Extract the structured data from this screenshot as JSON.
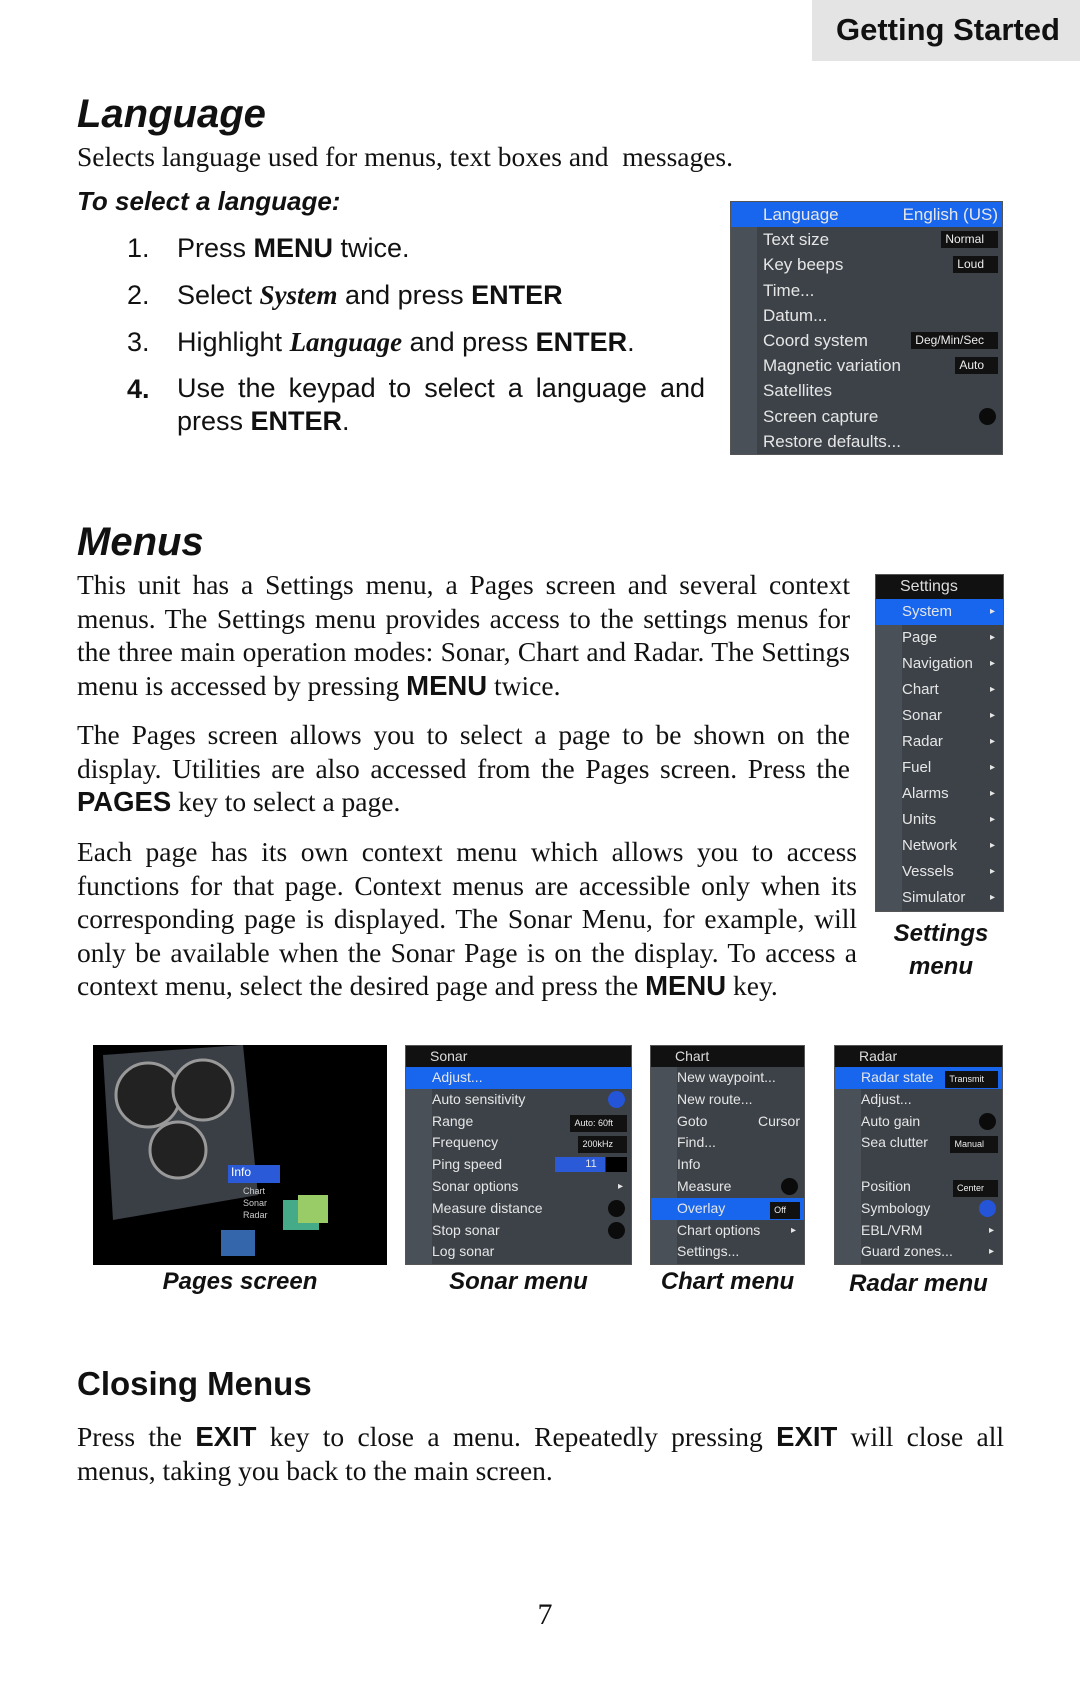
{
  "header": {
    "section": "Getting Started"
  },
  "language": {
    "title": "Language",
    "description": "Selects language used for menus, text boxes and  messages.",
    "howto": "To select a language:",
    "steps": [
      {
        "n": "1.",
        "parts": [
          [
            "Press ",
            ""
          ],
          [
            "MENU",
            "b"
          ],
          [
            " twice.",
            ""
          ]
        ]
      },
      {
        "n": "2.",
        "parts": [
          [
            "Select ",
            ""
          ],
          [
            "System",
            "i"
          ],
          [
            " and press ",
            ""
          ],
          [
            "ENTER",
            "b"
          ]
        ]
      },
      {
        "n": "3.",
        "parts": [
          [
            "Highlight ",
            ""
          ],
          [
            "Language",
            "i"
          ],
          [
            " and press ",
            ""
          ],
          [
            "ENTER",
            "b"
          ],
          [
            ".",
            ""
          ]
        ]
      },
      {
        "n": "4.",
        "parts": [
          [
            "Use the keypad to select a language and press ",
            ""
          ],
          [
            "ENTER",
            "b"
          ],
          [
            ".",
            ""
          ]
        ]
      }
    ],
    "screen": {
      "rows": [
        {
          "label": "Language",
          "value": "English (US)",
          "sel": true
        },
        {
          "label": "Text size",
          "dropdown": "Normal"
        },
        {
          "label": "Key beeps",
          "dropdown": "Loud"
        },
        {
          "label": "Time..."
        },
        {
          "label": "Datum..."
        },
        {
          "label": "Coord system",
          "dropdown": "Deg/Min/Sec"
        },
        {
          "label": "Magnetic variation",
          "dropdown": "Auto"
        },
        {
          "label": "Satellites"
        },
        {
          "label": "Screen capture",
          "toggle": "off"
        },
        {
          "label": "Restore defaults..."
        }
      ]
    }
  },
  "menus": {
    "title": "Menus",
    "p1": [
      [
        "This unit has a Settings menu, a Pages screen and several context menus. The Settings menu provides access to the settings menus for the three main operation modes: Sonar, Chart and Radar. The Settings menu is accessed by pressing ",
        ""
      ],
      [
        "MENU",
        "b"
      ],
      [
        " twice.",
        ""
      ]
    ],
    "p2": [
      [
        "The Pages screen allows you to select a page to be shown on the display. Utilities are also accessed from the Pages screen. Press the ",
        ""
      ],
      [
        "PAGES",
        "b"
      ],
      [
        " key to select a page.",
        ""
      ]
    ],
    "p3": [
      [
        "Each page has its own context menu which allows you to access functions for that page. Context menus are accessible only when its corresponding page is displayed. The Sonar Menu, for example, will only be available when the Sonar Page is on the display. To access a context menu, select the desired page and press the ",
        ""
      ],
      [
        "MENU",
        "b"
      ],
      [
        " key.",
        ""
      ]
    ],
    "settings": {
      "header": "Settings",
      "caption": "Settings menu",
      "items": [
        "System",
        "Page",
        "Navigation",
        "Chart",
        "Sonar",
        "Radar",
        "Fuel",
        "Alarms",
        "Units",
        "Network",
        "Vessels",
        "Simulator"
      ],
      "selected": "System"
    },
    "pages": {
      "caption": "Pages screen",
      "labels": [
        "Info",
        "Chart",
        "Sonar",
        "Radar"
      ]
    },
    "sonar": {
      "header": "Sonar",
      "caption": "Sonar menu",
      "rows": [
        {
          "label": "Adjust...",
          "sel": true
        },
        {
          "label": "Auto sensitivity",
          "toggle": "on"
        },
        {
          "label": "Range",
          "dropdown": "Auto: 60ft"
        },
        {
          "label": "Frequency",
          "dropdown": "200kHz"
        },
        {
          "label": "Ping speed",
          "slider": "11"
        },
        {
          "label": "Sonar options",
          "arrow": true
        },
        {
          "label": "Measure distance",
          "toggle": "off"
        },
        {
          "label": "Stop sonar",
          "toggle": "off"
        },
        {
          "label": "Log sonar"
        }
      ]
    },
    "chart": {
      "header": "Chart",
      "caption": "Chart menu",
      "rows": [
        {
          "label": "New waypoint..."
        },
        {
          "label": "New route..."
        },
        {
          "label": "Goto",
          "value": "Cursor"
        },
        {
          "label": "Find..."
        },
        {
          "label": "Info"
        },
        {
          "label": "Measure",
          "toggle": "off"
        },
        {
          "label": "Overlay",
          "dropdown": "Off",
          "sel": true
        },
        {
          "label": "Chart options",
          "arrow": true
        },
        {
          "label": "Settings..."
        }
      ]
    },
    "radar": {
      "header": "Radar",
      "caption": "Radar menu",
      "rows": [
        {
          "label": "Radar state",
          "dropdown": "Transmit",
          "sel": true
        },
        {
          "label": "Adjust..."
        },
        {
          "label": "Auto gain",
          "toggle": "off"
        },
        {
          "label": "Sea clutter",
          "dropdown": "Manual"
        },
        {
          "label": ""
        },
        {
          "label": "Position",
          "dropdown": "Center"
        },
        {
          "label": "Symbology",
          "toggle": "on"
        },
        {
          "label": "EBL/VRM",
          "arrow": true
        },
        {
          "label": "Guard zones...",
          "arrow": true
        }
      ]
    }
  },
  "closing": {
    "title": "Closing Menus",
    "p": [
      [
        "Press the ",
        ""
      ],
      [
        "EXIT",
        "b"
      ],
      [
        " key to close a menu. Repeatedly pressing ",
        ""
      ],
      [
        "EXIT",
        "b"
      ],
      [
        " will close all menus, taking you back to the main screen.",
        ""
      ]
    ]
  },
  "page_number": "7"
}
